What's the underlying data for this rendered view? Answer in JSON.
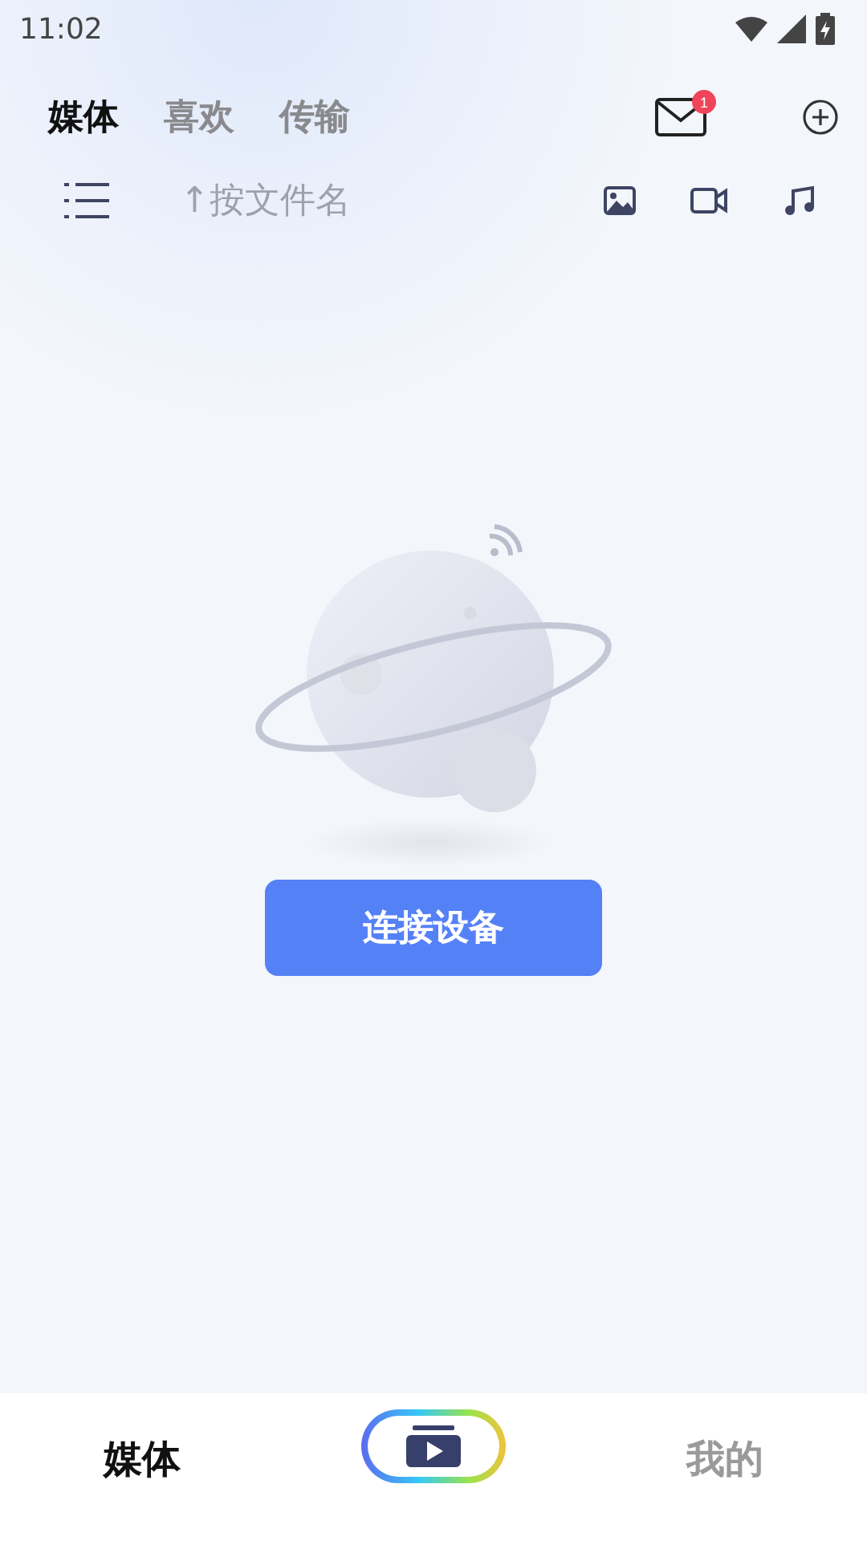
{
  "status_bar": {
    "time": "11:02"
  },
  "tabs": [
    {
      "label": "媒体",
      "selected": true
    },
    {
      "label": "喜欢",
      "selected": false
    },
    {
      "label": "传输",
      "selected": false
    }
  ],
  "mail": {
    "badge": "1"
  },
  "sort": {
    "label": "↑按文件名"
  },
  "filters": [
    {
      "kind": "image"
    },
    {
      "kind": "video"
    },
    {
      "kind": "music"
    }
  ],
  "connect_button": {
    "label": "连接设备"
  },
  "bottom_nav": [
    {
      "kind": "text",
      "label": "媒体",
      "selected": true
    },
    {
      "kind": "player",
      "selected": false
    },
    {
      "kind": "text",
      "label": "我的",
      "selected": false
    }
  ]
}
